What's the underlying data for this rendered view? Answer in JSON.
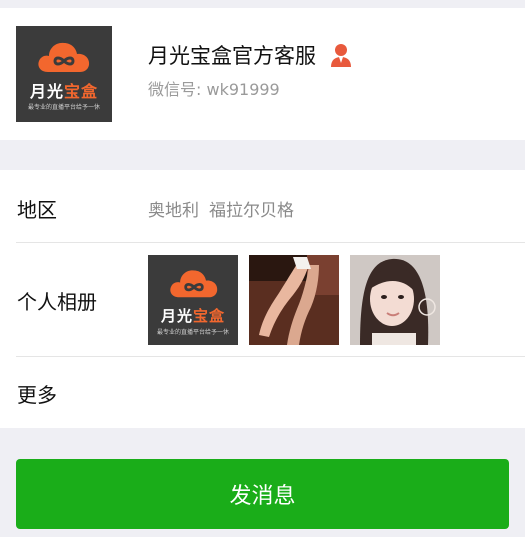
{
  "profile": {
    "name": "月光宝盒官方客服",
    "wechat_id": "微信号: wk91999",
    "contact_icon": "person-icon",
    "avatar": {
      "brand_prefix": "月光",
      "brand_highlight": "宝盒",
      "slogan": "最专业的直播平台给予一休"
    }
  },
  "details": {
    "region": {
      "label": "地区",
      "country": "奥地利",
      "city": "福拉尔贝格"
    },
    "album": {
      "label": "个人相册",
      "thumbs": [
        {
          "brand_prefix": "月光",
          "brand_highlight": "宝盒",
          "slogan": "最专业的直播平台给予一休"
        },
        {
          "kind": "photo"
        },
        {
          "kind": "photo"
        }
      ]
    },
    "more": {
      "label": "更多"
    }
  },
  "actions": {
    "send_label": "发消息"
  },
  "colors": {
    "accent": "#1aad19",
    "brand": "#f2672e",
    "background": "#efeff4"
  }
}
